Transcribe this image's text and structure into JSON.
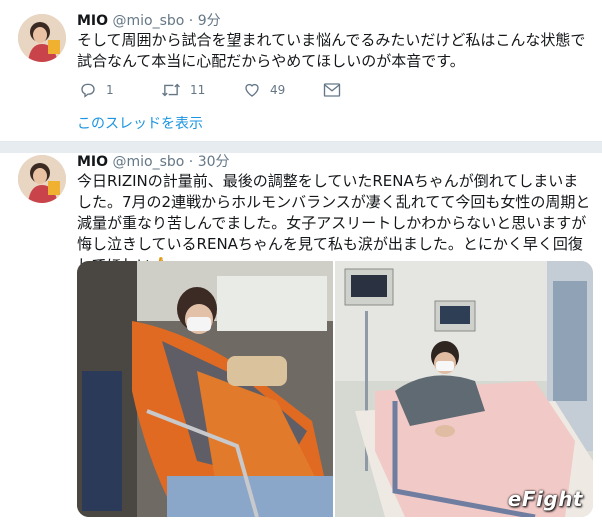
{
  "tweet1": {
    "name": "MIO",
    "handle": "@mio_sbo",
    "time": "· 9分",
    "text": "そして周囲から試合を望まれていま悩んでるみたいだけど私はこんな状態で試合なんて本当に心配だからやめてほしいのが本音です。",
    "replies": "1",
    "retweets": "11",
    "likes": "49",
    "thread_link": "このスレッドを表示"
  },
  "tweet2": {
    "name": "MIO",
    "handle": "@mio_sbo",
    "time": "· 30分",
    "text": "今日RIZINの計量前、最後の調整をしていたRENAちゃんが倒れてしまいました。7月の2連戦からホルモンバランスが凄く乱れてて今回も女性の周期と減量が重なり苦しんでました。女子アスリートしかわからないと思いますが悔し泣きしているRENAちゃんを見て私も涙が出ました。とにかく早く回復してほしい🙏"
  },
  "watermark": "eFight",
  "colors": {
    "link": "#1b95e0",
    "secondary_text": "#657786",
    "divider": "#e6ecf0"
  },
  "icons": [
    "reply-icon",
    "retweet-icon",
    "like-icon",
    "dm-icon"
  ]
}
